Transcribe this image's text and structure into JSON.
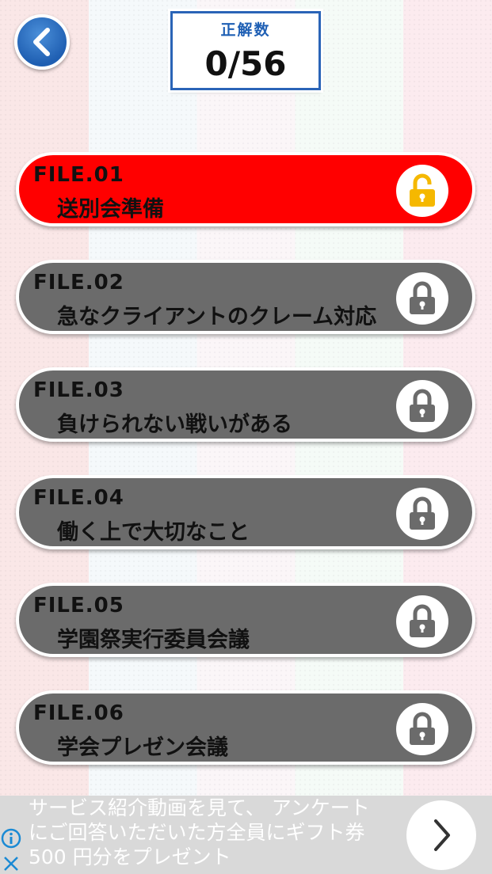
{
  "header": {
    "back_icon": "chevron-left-icon",
    "score_label": "正解数",
    "score_value": "0/56"
  },
  "files": [
    {
      "number": "FILE.01",
      "title": "送別会準備",
      "state": "unlocked",
      "color": "#ff0000",
      "lock_color": "#f5b800"
    },
    {
      "number": "FILE.02",
      "title": "急なクライアントのクレーム対応",
      "state": "locked",
      "color": "#6b6b6b",
      "lock_color": "#6b6b6b"
    },
    {
      "number": "FILE.03",
      "title": "負けられない戦いがある",
      "state": "locked",
      "color": "#6b6b6b",
      "lock_color": "#6b6b6b"
    },
    {
      "number": "FILE.04",
      "title": "働く上で大切なこと",
      "state": "locked",
      "color": "#6b6b6b",
      "lock_color": "#6b6b6b"
    },
    {
      "number": "FILE.05",
      "title": "学園祭実行委員会議",
      "state": "locked",
      "color": "#6b6b6b",
      "lock_color": "#6b6b6b"
    },
    {
      "number": "FILE.06",
      "title": "学会プレゼン会議",
      "state": "locked",
      "color": "#6b6b6b",
      "lock_color": "#6b6b6b"
    }
  ],
  "ad": {
    "line1": "サービス紹介動画を見て、 アンケート",
    "line2": "にご回答いただいた方全員にギフト券",
    "line3": "500 円分をプレゼント",
    "info_icon": "info-icon",
    "close_icon": "close-icon",
    "arrow_icon": "chevron-right-icon"
  },
  "colors": {
    "accent_blue": "#1e5fb4",
    "active_red": "#ff0000",
    "locked_gray": "#6b6b6b",
    "ad_info_blue": "#1a8ad4"
  }
}
